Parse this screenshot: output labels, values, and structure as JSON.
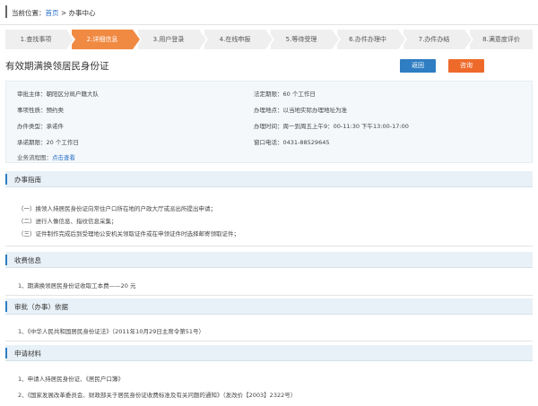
{
  "breadcrumb": {
    "prefix": "当前位置：",
    "home": "首页",
    "sep": " > ",
    "current": "办事中心"
  },
  "steps": [
    {
      "label": "1.查找事项",
      "active": false
    },
    {
      "label": "2.详细信息",
      "active": true
    },
    {
      "label": "3.用户登录",
      "active": false
    },
    {
      "label": "4.在线申报",
      "active": false
    },
    {
      "label": "5.等待受理",
      "active": false
    },
    {
      "label": "6.办件办理中",
      "active": false
    },
    {
      "label": "7.办件办结",
      "active": false
    },
    {
      "label": "8.满意度评价",
      "active": false
    }
  ],
  "page_title": "有效期满换领居民身份证",
  "buttons": {
    "back": "返回",
    "ask": "咨询"
  },
  "info": {
    "approver": "审批主体：朝阳区分局户籍大队",
    "legal_period": "法定期限：60 个工作日",
    "item_type": "事项性质：预约类",
    "location": "办理地点：以当地实际办理地址为准",
    "case_type": "办件类型：承诺件",
    "hours": "办理时间：周一到周五上午9：00-11:30 下午13:00-17:00",
    "promise_period": "承诺期限：20 个工作日",
    "phone": "窗口电话：0431-88529645",
    "flow_label": "业务流程图：",
    "flow_link": "点击查看"
  },
  "sections": {
    "guide": {
      "title": "办事指南",
      "lines": [
        "（一）换领人持居民身份证向常住户口所在地的户政大厅或派出所提出申请；",
        "（二）进行人像信息、指纹信息采集；",
        "（三）证件制作完成后到受理地公安机关领取证件或在申领证件时选择邮寄领取证件；"
      ]
    },
    "fee": {
      "title": "收费信息",
      "lines": [
        "1、期满换领居民身份证收取工本费——20 元"
      ]
    },
    "basis": {
      "title": "审批（办事）依据",
      "lines": [
        "1、《中华人民共和国居民身份证法》（2011年10月29日主席令第51号）"
      ]
    },
    "materials": {
      "title": "申请材料",
      "lines": [
        "1、申请人持居民身份证、《居民户口簿》",
        "2、《国家发展改革委员会、财政部关于居民身份证收费标准及有关问题的通知》（发改价【2003】2322号）"
      ]
    }
  },
  "colors": {
    "accent": "#f08a43",
    "primary": "#2f7dc2",
    "ask": "#ee6a2b"
  }
}
